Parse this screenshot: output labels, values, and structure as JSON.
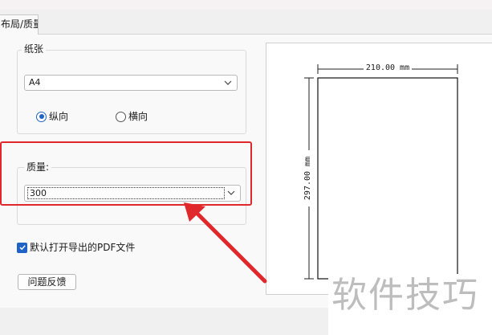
{
  "tab": {
    "label": "布局/质量"
  },
  "paper": {
    "group_label": "纸张",
    "size_value": "A4",
    "orientation": {
      "portrait": "纵向",
      "landscape": "横向",
      "selected": "portrait"
    }
  },
  "quality": {
    "group_label": "质量:",
    "value": "300"
  },
  "open_pdf": {
    "label": "默认打开导出的PDF文件",
    "checked": true
  },
  "feedback": {
    "label": "问题反馈"
  },
  "preview": {
    "width_label": "210.00 mm",
    "height_label": "297.00 mm"
  },
  "watermark": {
    "text": "软件技巧"
  },
  "colors": {
    "accent": "#1f63c6",
    "highlight": "#e0282c"
  },
  "icons": [
    "chevron-down-icon",
    "check-icon",
    "arrow-icon"
  ]
}
